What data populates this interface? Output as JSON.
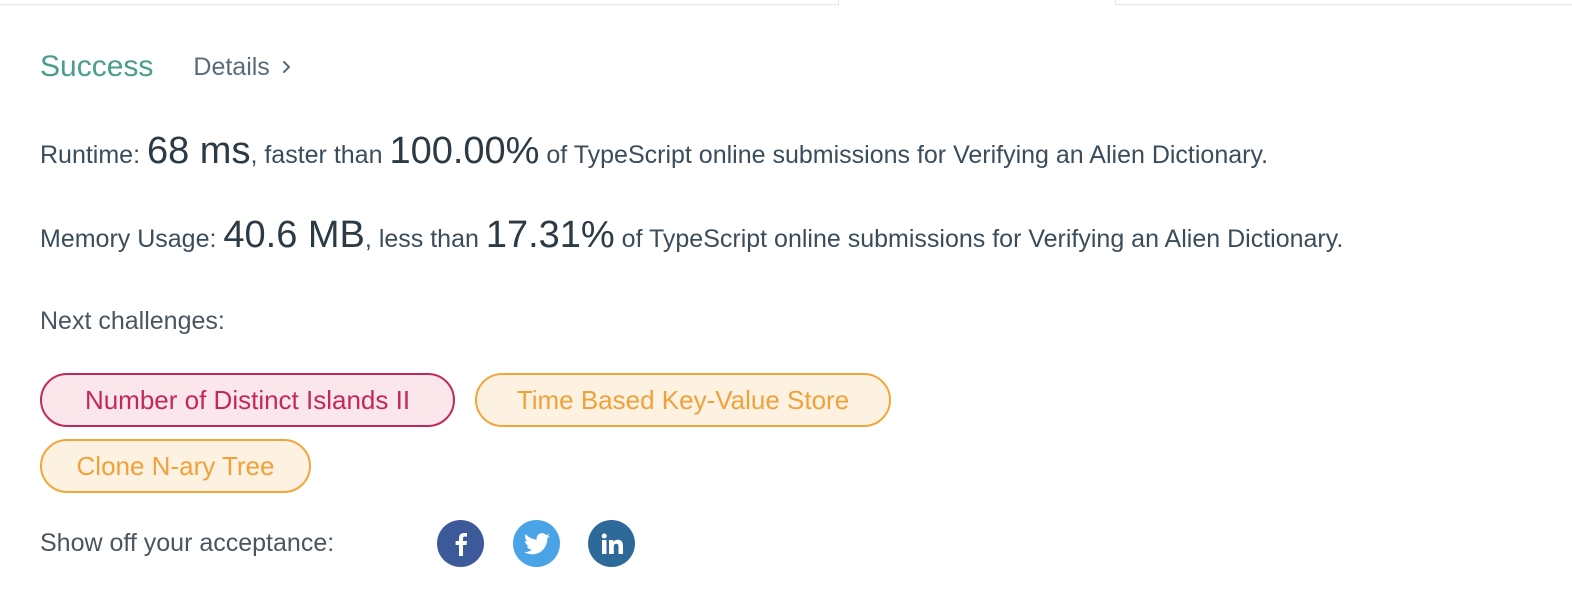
{
  "status": {
    "result": "Success",
    "details_label": "Details"
  },
  "runtime": {
    "label": "Runtime: ",
    "value": "68 ms",
    "compare_text": ", faster than ",
    "percent": "100.00%",
    "suffix": " of TypeScript online submissions for Verifying an Alien Dictionary."
  },
  "memory": {
    "label": "Memory Usage: ",
    "value": "40.6 MB",
    "compare_text": ", less than ",
    "percent": "17.31%",
    "suffix": " of TypeScript online submissions for Verifying an Alien Dictionary."
  },
  "next_challenges": {
    "label": "Next challenges:",
    "items": [
      {
        "title": "Number of Distinct Islands II",
        "difficulty_color": "#c4285a"
      },
      {
        "title": "Time Based Key-Value Store",
        "difficulty_color": "#f2a63a"
      },
      {
        "title": "Clone N-ary Tree",
        "difficulty_color": "#f2a63a"
      }
    ]
  },
  "share": {
    "label": "Show off your acceptance:",
    "icons": [
      "facebook-icon",
      "twitter-icon",
      "linkedin-icon"
    ]
  },
  "colors": {
    "success": "#4a9f8a",
    "hard": "#c4285a",
    "medium": "#f2a63a",
    "facebook": "#3c5a99",
    "twitter": "#4aa3e6",
    "linkedin": "#2d6a9a"
  }
}
